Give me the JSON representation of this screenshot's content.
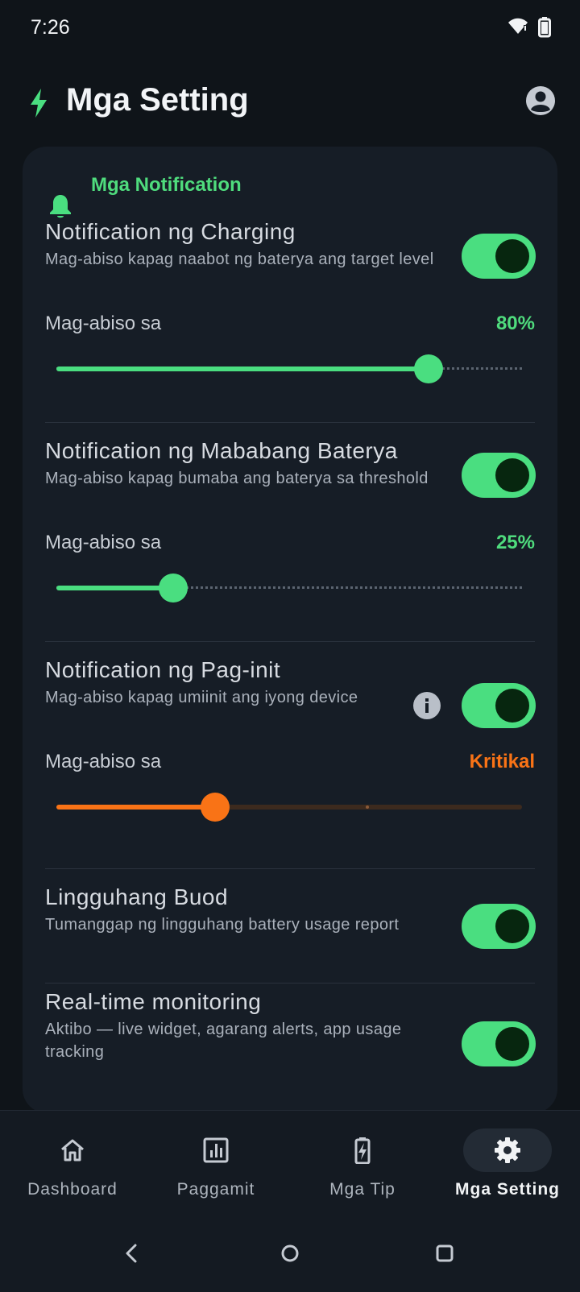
{
  "status_bar": {
    "time": "7:26"
  },
  "header": {
    "title": "Mga Setting"
  },
  "notifications_section": {
    "label": "Mga Notification"
  },
  "settings": [
    {
      "title": "Notification ng Charging",
      "description": "Mag-abiso kapag naabot ng baterya ang target level",
      "enabled": true,
      "notify_label": "Mag-abiso sa",
      "notify_value": "80%",
      "slider_value": 0.8
    },
    {
      "title": "Notification ng Mababang Baterya",
      "description": "Mag-abiso kapag bumaba ang baterya sa threshold",
      "enabled": true,
      "notify_label": "Mag-abiso sa",
      "notify_value": "25%",
      "slider_value": 0.25
    },
    {
      "title": "Notification ng Pag-init",
      "description": "Mag-abiso kapag umiinit ang iyong device",
      "enabled": true,
      "notify_label": "Mag-abiso sa",
      "notify_value": "Kritikal",
      "slider_value": 0.34
    },
    {
      "title": "Lingguhang Buod",
      "description": "Tumanggap ng lingguhang battery usage report",
      "enabled": true
    },
    {
      "title": "Real-time monitoring",
      "description": "Aktibo — live widget, agarang alerts, app usage tracking",
      "enabled": true
    }
  ],
  "bottom_nav": {
    "items": [
      {
        "label": "Dashboard",
        "icon": "home-icon"
      },
      {
        "label": "Paggamit",
        "icon": "chart-icon"
      },
      {
        "label": "Mga Tip",
        "icon": "battery-bolt-icon"
      },
      {
        "label": "Mga Setting",
        "icon": "gear-icon",
        "active": true
      }
    ]
  },
  "colors": {
    "accent_green": "#4ade80",
    "accent_orange": "#f97316",
    "background": "#0f1419",
    "card": "#161d26"
  }
}
